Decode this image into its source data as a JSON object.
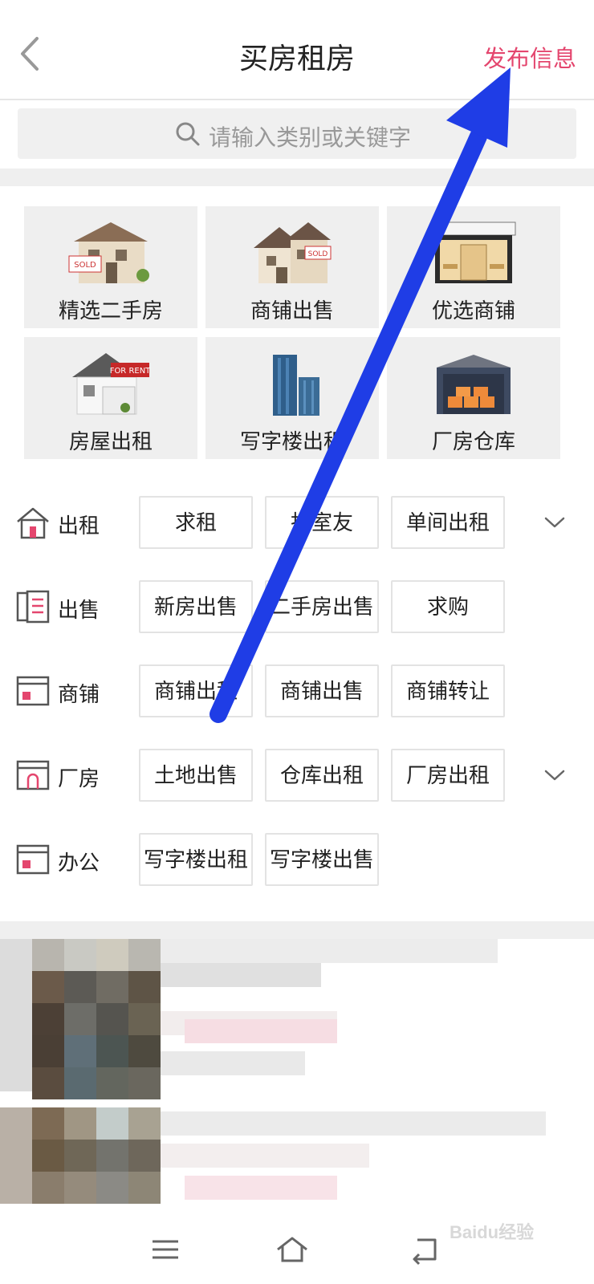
{
  "header": {
    "title": "买房租房",
    "publish_label": "发布信息"
  },
  "search": {
    "placeholder": "请输入类别或关键字"
  },
  "categories": [
    {
      "label": "精选二手房",
      "icon": "house-sold-icon"
    },
    {
      "label": "商铺出售",
      "icon": "villa-sold-icon"
    },
    {
      "label": "优选商铺",
      "icon": "storefront-icon"
    },
    {
      "label": "房屋出租",
      "icon": "house-for-rent-icon"
    },
    {
      "label": "写字楼出租",
      "icon": "office-tower-icon"
    },
    {
      "label": "厂房仓库",
      "icon": "warehouse-icon"
    }
  ],
  "rows": [
    {
      "label": "出租",
      "icon": "house-outline-icon",
      "chips": [
        "求租",
        "找室友",
        "单间出租"
      ],
      "expandable": true
    },
    {
      "label": "出售",
      "icon": "document-outline-icon",
      "chips": [
        "新房出售",
        "二手房出售",
        "求购"
      ],
      "expandable": false
    },
    {
      "label": "商铺",
      "icon": "shop-outline-icon",
      "chips": [
        "商铺出租",
        "商铺出售",
        "商铺转让"
      ],
      "expandable": false
    },
    {
      "label": "厂房",
      "icon": "factory-outline-icon",
      "chips": [
        "土地出售",
        "仓库出租",
        "厂房出租"
      ],
      "expandable": true
    },
    {
      "label": "办公",
      "icon": "office-outline-icon",
      "chips": [
        "写字楼出租",
        "写字楼出售"
      ],
      "expandable": false
    }
  ],
  "bottom_nav": [
    "menu-icon",
    "home-icon",
    "back-icon"
  ],
  "watermark": "Baidu经验",
  "colors": {
    "accent": "#e4466e",
    "arrow": "#1f3de6"
  }
}
